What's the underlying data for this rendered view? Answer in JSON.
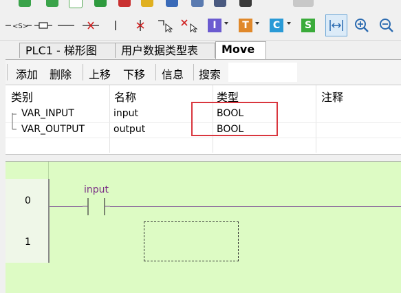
{
  "tabs": [
    {
      "label": "PLC1 - 梯形图"
    },
    {
      "label": "用户数据类型表"
    },
    {
      "label": "Move"
    }
  ],
  "ladder_toolbar": {
    "buttons": [
      {
        "icon": "contact-set-icon"
      },
      {
        "icon": "coil-icon"
      },
      {
        "icon": "horizontal-line-icon"
      },
      {
        "icon": "delete-line-icon"
      },
      {
        "icon": "vertical-line-icon"
      },
      {
        "icon": "delete-vertical-line-icon"
      },
      {
        "icon": "draw-line-icon"
      },
      {
        "icon": "delete-draw-line-icon"
      },
      {
        "letter": "I",
        "color": "#6b5bd0"
      },
      {
        "letter": "T",
        "color": "#e0882a"
      },
      {
        "letter": "C",
        "color": "#2a9ad6"
      },
      {
        "letter": "S",
        "color": "#3aab3a"
      },
      {
        "icon": "fit-width-icon"
      },
      {
        "icon": "zoom-in-icon"
      },
      {
        "icon": "zoom-out-icon"
      }
    ]
  },
  "actions": {
    "add": "添加",
    "delete": "删除",
    "move_up": "上移",
    "move_down": "下移",
    "info": "信息",
    "search": "搜索",
    "search_value": ""
  },
  "var_table": {
    "columns": [
      "类别",
      "名称",
      "类型",
      "注释"
    ],
    "rows": [
      {
        "category": "VAR_INPUT",
        "name": "input",
        "type": "BOOL",
        "comment": ""
      },
      {
        "category": "VAR_OUTPUT",
        "name": "output",
        "type": "BOOL",
        "comment": ""
      }
    ]
  },
  "ladder": {
    "rows": [
      "0",
      "1"
    ],
    "contact_label": "input"
  },
  "colors": {
    "ladder_bg": "#ddfbc4",
    "highlight": "#d9363e",
    "contact": "#7a2e86"
  }
}
